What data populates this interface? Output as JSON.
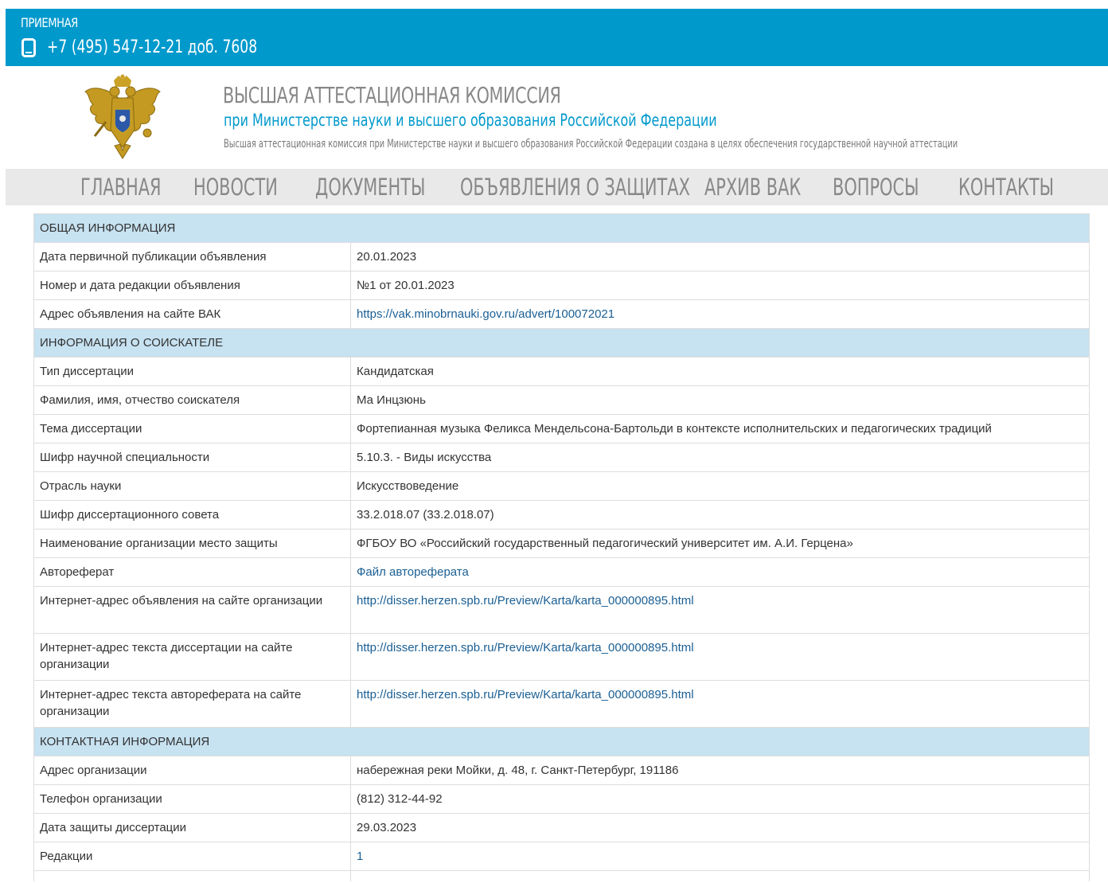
{
  "topbar": {
    "reception_label": "ПРИЕМНАЯ",
    "phone": "+7 (495) 547-12-21 доб. 7608",
    "phone_icon": "mobile-phone-icon",
    "bg_color": "#0099cc"
  },
  "header": {
    "title": "ВЫСШАЯ АТТЕСТАЦИОННАЯ КОМИССИЯ",
    "subtitle": "при Министерстве науки и высшего образования Российской Федерации",
    "description": "Высшая аттестационная комиссия при Министерстве науки и высшего образования Российской Федерации создана в целях обеспечения государственной научной аттестации",
    "emblem_icon": "russian-coat-of-arms-emblem"
  },
  "nav": {
    "items": [
      "ГЛАВНАЯ",
      "НОВОСТИ",
      "ДОКУМЕНТЫ",
      "ОБЪЯВЛЕНИЯ О ЗАЩИТАХ",
      "АРХИВ ВАК",
      "ВОПРОСЫ",
      "КОНТАКТЫ"
    ]
  },
  "sections": {
    "general": "ОБЩАЯ ИНФОРМАЦИЯ",
    "applicant": "ИНФОРМАЦИЯ О СОИСКАТЕЛЕ",
    "contact": "КОНТАКТНАЯ ИНФОРМАЦИЯ"
  },
  "rows": {
    "pub_date": {
      "label": "Дата первичной публикации объявления",
      "value": "20.01.2023"
    },
    "edition": {
      "label": "Номер и дата редакции объявления",
      "value": "№1 от 20.01.2023"
    },
    "vak_url": {
      "label": "Адрес объявления на сайте ВАК",
      "value": "https://vak.minobrnauki.gov.ru/advert/100072021"
    },
    "diss_type": {
      "label": "Тип диссертации",
      "value": "Кандидатская"
    },
    "name": {
      "label": "Фамилия, имя, отчество соискателя",
      "value": "Ма Инцзюнь"
    },
    "topic": {
      "label": "Тема диссертации",
      "value": "Фортепианная музыка Феликса Мендельсона-Бартольди в контексте исполнительских и педагогических традиций"
    },
    "specialty": {
      "label": "Шифр научной специальности",
      "value": "5.10.3. - Виды искусства"
    },
    "branch": {
      "label": "Отрасль науки",
      "value": "Искусствоведение"
    },
    "council": {
      "label": "Шифр диссертационного совета",
      "value": "33.2.018.07 (33.2.018.07)"
    },
    "org": {
      "label": "Наименование организации место защиты",
      "value": "ФГБОУ ВО «Российский государственный педагогический университет им. А.И. Герцена»"
    },
    "abstract": {
      "label": "Автореферат",
      "value": "Файл автореферата"
    },
    "org_url": {
      "label": "Интернет-адрес объявления на сайте организации",
      "value": "http://disser.herzen.spb.ru/Preview/Karta/karta_000000895.html"
    },
    "diss_url": {
      "label": "Интернет-адрес текста диссертации на сайте организации",
      "value": "http://disser.herzen.spb.ru/Preview/Karta/karta_000000895.html"
    },
    "abstract_url": {
      "label": "Интернет-адрес текста автореферата на сайте организации",
      "value": "http://disser.herzen.spb.ru/Preview/Karta/karta_000000895.html"
    },
    "address": {
      "label": "Адрес организации",
      "value": "набережная реки Мойки, д. 48, г. Санкт-Петербург, 191186"
    },
    "phone": {
      "label": "Телефон организации",
      "value": "(812) 312-44-92"
    },
    "defense_date": {
      "label": "Дата защиты диссертации",
      "value": "29.03.2023"
    },
    "editions": {
      "label": "Редакции",
      "value": "1"
    }
  },
  "colors": {
    "section_bg": "#c7e2f1",
    "link": "#1a5f94",
    "nav_bg": "#e9e9e9"
  }
}
